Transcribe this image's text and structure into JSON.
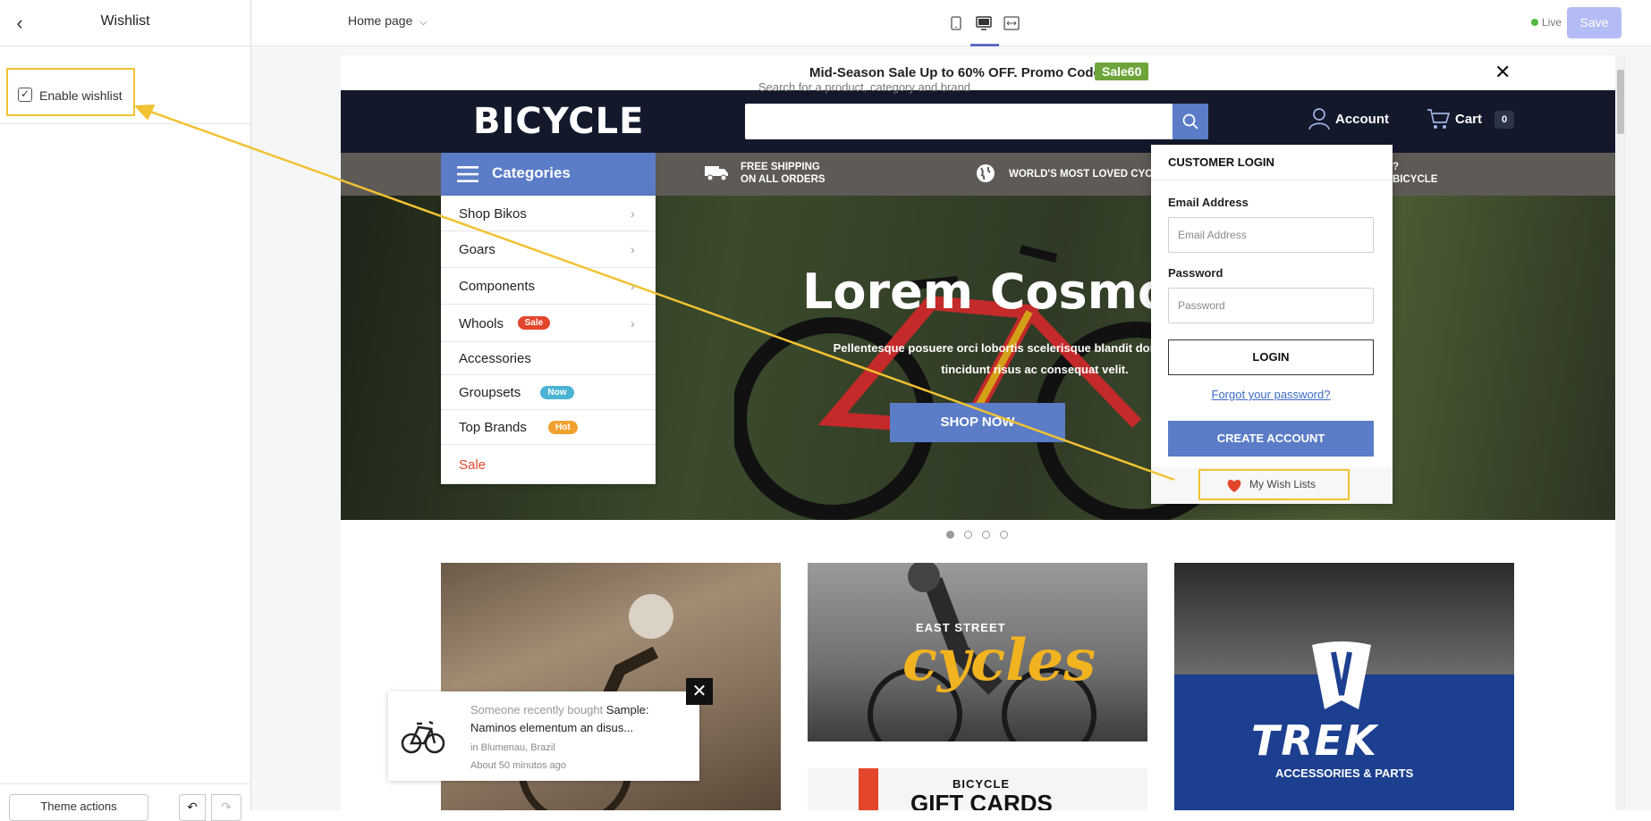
{
  "editor": {
    "sidebar": {
      "title": "Wishlist",
      "enable_wishlist_label": "Enable wishlist",
      "enable_wishlist_checked": true,
      "theme_actions_label": "Theme actions"
    },
    "topbar": {
      "page_select": "Home page",
      "live_label": "Live",
      "save_label": "Save",
      "devices": [
        "mobile-icon",
        "desktop-icon",
        "full-width-icon"
      ],
      "active_device": "desktop-icon"
    }
  },
  "site": {
    "promo": {
      "text": "Mid-Season Sale Up to 60% OFF. Promo Code",
      "code": "Sale60"
    },
    "header": {
      "logo": "BICYCLE",
      "search_placeholder": "Search for a product, category and brand",
      "account_label": "Account",
      "cart_label": "Cart",
      "cart_count": "0"
    },
    "categories": {
      "title": "Categories",
      "items": [
        {
          "label": "Shop Bikos",
          "arrow": true
        },
        {
          "label": "Goars",
          "arrow": true
        },
        {
          "label": "Components",
          "arrow": true
        },
        {
          "label": "Whools",
          "badge": "Sale",
          "badge_color": "#e2462b",
          "arrow": true
        },
        {
          "label": "Accessories"
        },
        {
          "label": "Groupsets",
          "badge": "Now",
          "badge_color": "#4bb4d6"
        },
        {
          "label": "Top Brands",
          "badge": "Hot",
          "badge_color": "#f0a22e"
        },
        {
          "label": "Sale",
          "color": "#e2462b"
        }
      ]
    },
    "features": [
      {
        "line1": "FREE SHIPPING",
        "line2": "ON ALL ORDERS"
      },
      {
        "line1": "WORLD'S MOST LOVED CYC"
      },
      {
        "line1": "?",
        "line2": "BICYCLE"
      }
    ],
    "hero": {
      "title": "Lorem Cosmor",
      "subtitle_line1": "Pellentesque posuere orci lobortis scelerisque blandit donec id tellus lac",
      "subtitle_line2": "tincidunt risus ac consequat velit.",
      "button": "SHOP NOW",
      "slides": 4,
      "active_slide": 0
    },
    "login": {
      "title": "CUSTOMER LOGIN",
      "email_label": "Email Address",
      "email_placeholder": "Email Address",
      "password_label": "Password",
      "password_placeholder": "Password",
      "login_button": "LOGIN",
      "forgot_link": "Forgot your password?",
      "create_button": "CREATE ACCOUNT",
      "wishlist_link": "My Wish Lists"
    },
    "tiles": {
      "east_street": "EAST STREET",
      "cycles": "cycles",
      "trek": "TREK",
      "trek_sub": "ACCESSORIES & PARTS",
      "gift_small": "BICYCLE",
      "gift_big": "GIFT CARDS"
    },
    "sales_popup": {
      "prefix": "Someone recently bought",
      "product_start": "Sample:",
      "product_rest": "Naminos elementum an disus...",
      "location": "in Blumenau, Brazil",
      "time": "About 50 minutos ago"
    }
  },
  "colors": {
    "accent": "#5b7cc7",
    "highlight": "#f1c232",
    "header_bg": "#13192b",
    "promo_code": "#6ea53a"
  }
}
